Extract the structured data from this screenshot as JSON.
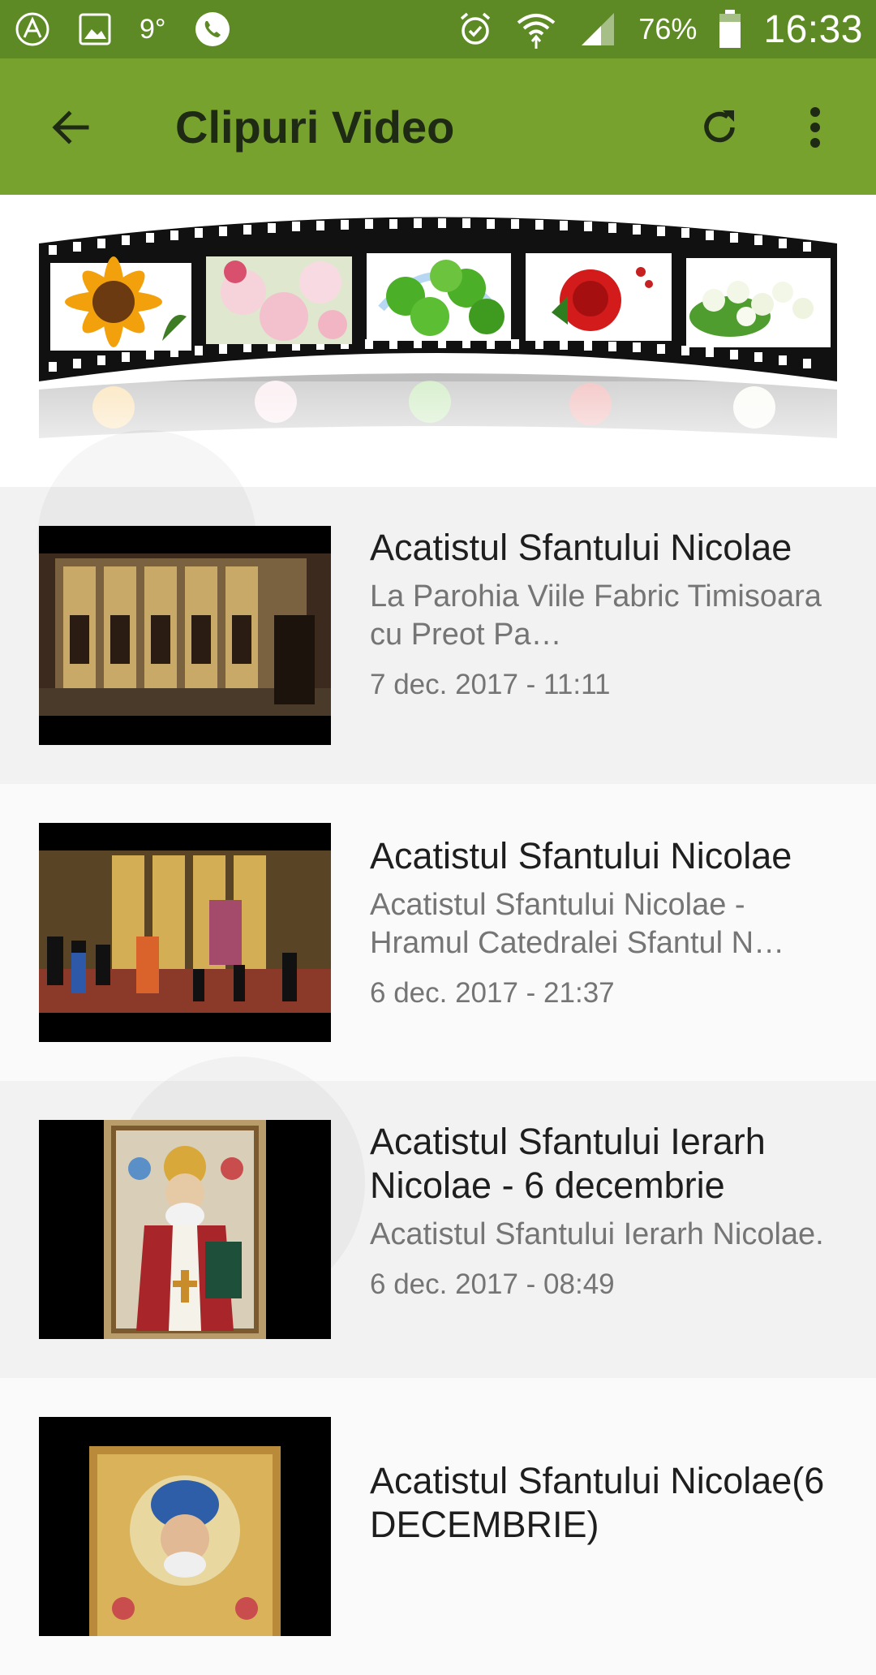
{
  "status_bar": {
    "temperature": "9°",
    "battery": "76%",
    "time": "16:33",
    "left_icons": [
      "app-circle-icon",
      "image-icon",
      "phone-icon"
    ],
    "right_icons": [
      "alarm-icon",
      "wifi-icon",
      "signal-icon",
      "battery-icon"
    ]
  },
  "app_bar": {
    "title": "Clipuri Video",
    "back_icon": "arrow-back-icon",
    "refresh_icon": "refresh-icon",
    "menu_icon": "more-vert-icon",
    "background": "#76a22d"
  },
  "banner": {
    "description_icon": "film-strip-flowers"
  },
  "videos": [
    {
      "title": "Acatistul Sfantului Nicolae",
      "description": "La Parohia Viile Fabric Timisoara cu Preot Pa…",
      "date": "7 dec. 2017 - 11:11"
    },
    {
      "title": "Acatistul Sfantului Nicolae",
      "description": "Acatistul Sfantului Nicolae - Hramul Catedralei Sfantul N…",
      "date": "6 dec. 2017 - 21:37"
    },
    {
      "title": "Acatistul Sfantului Ierarh Nicolae - 6 decembrie",
      "description": "Acatistul Sfantului Ierarh Nicolae.",
      "date": "6 dec. 2017 - 08:49"
    },
    {
      "title": "Acatistul Sfantului Nicolae(6 DECEMBRIE)",
      "description": "",
      "date": ""
    }
  ]
}
